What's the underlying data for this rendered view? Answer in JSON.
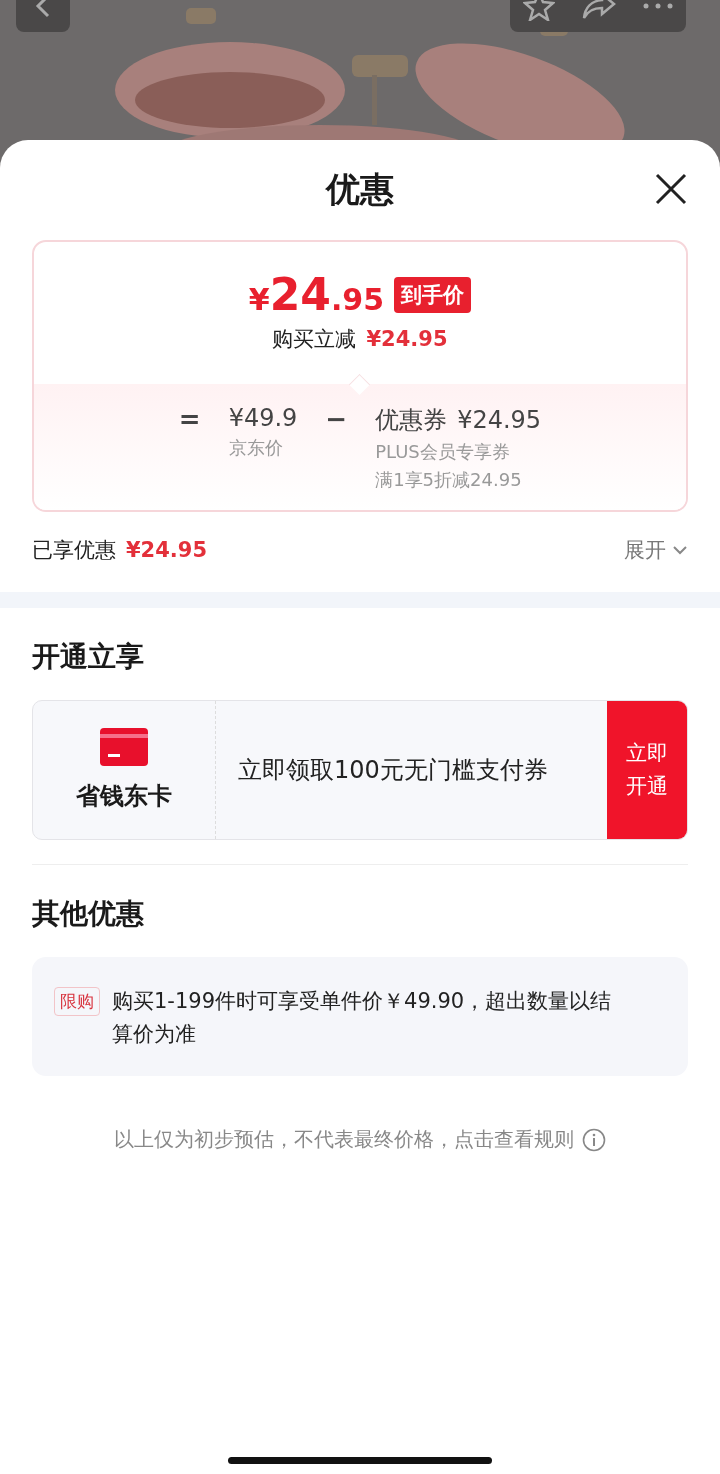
{
  "sheet": {
    "title": "优惠"
  },
  "price_box": {
    "price": "¥24.95",
    "price_tag": "到手价",
    "reduction_label": "购买立减",
    "reduction_value": "¥24.95",
    "formula": {
      "equals": "=",
      "base_price": "¥49.9",
      "base_label": "京东价",
      "minus": "−",
      "coupon_name": "优惠券",
      "coupon_value": "¥24.95",
      "coupon_lines": [
        "PLUS会员专享券",
        "满1享5折减24.95"
      ]
    }
  },
  "enjoyed": {
    "label": "已享优惠",
    "value": "¥24.95",
    "expand": "展开"
  },
  "open_section": {
    "title": "开通立享",
    "card_name": "省钱东卡",
    "offer": "立即领取100元无门槛支付券",
    "action": "立即开通"
  },
  "other_section": {
    "title": "其他优惠",
    "items": [
      {
        "tag": "限购",
        "text": "购买1-199件时可享受单件价￥49.90，超出数量以结算价为准"
      }
    ]
  },
  "footnote": "以上仅为初步预估，不代表最终价格，点击查看规则"
}
